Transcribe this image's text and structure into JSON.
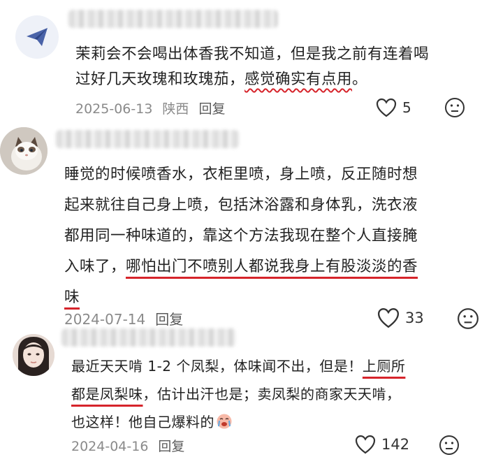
{
  "comments": [
    {
      "avatar_icon": "paper-plane-icon",
      "text_lines": [
        "茉莉会不会喝出体香我不知道，但是我之前有连着喝",
        "过好几天玫瑰和玫瑰茄，"
      ],
      "highlight": "感觉确实有点用",
      "tail": "。",
      "date": "2025-06-13",
      "location": "陕西",
      "reply": "回复",
      "likes": "5"
    },
    {
      "avatar_icon": "cat-photo",
      "text_lines": [
        "睡觉的时候喷香水，衣柜里喷，身上喷，反正随时想",
        "起来就往自己身上喷，包括沐浴露和身体乳，洗衣液",
        "都用同一种味道的，靠这个方法我现在整个人直接腌"
      ],
      "line4_plain": "入味了，",
      "line4_ul": "哪怕出门不喷别人都说我身上有股淡淡的香",
      "line5_ul": "味",
      "date": "2024-07-14",
      "reply": "回复",
      "likes": "33"
    },
    {
      "avatar_icon": "woman-photo",
      "line1_plain": "最近天天啃 1-2 个凤梨，体味闻不出，但是！",
      "line1_ul": "上厕所",
      "line2_ul1": "都是",
      "line2_ul2": "凤梨味",
      "line2_plain": "，估计出汗也是；卖凤梨的商家天天啃，",
      "line3": "也这样！他自己爆料的",
      "emoji": "crying-face-emoji",
      "date": "2024-04-16",
      "reply": "回复",
      "likes": "142"
    }
  ],
  "colors": {
    "accent_underline": "#d6242b",
    "meta": "#8a8a8a"
  }
}
